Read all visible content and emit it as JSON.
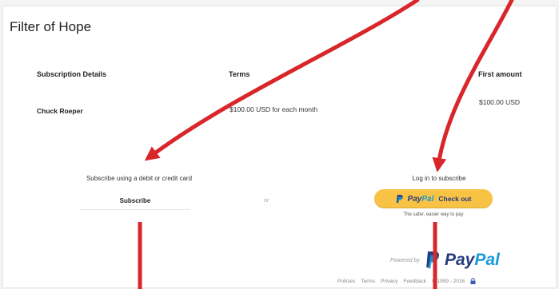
{
  "merchant": {
    "title": "Filter of Hope"
  },
  "table": {
    "headers": [
      "Subscription Details",
      "Terms",
      "First amount"
    ],
    "row": {
      "name": "Chuck Roeper",
      "terms": "$100.00 USD for each month",
      "amount": "$100.00 USD"
    }
  },
  "card": {
    "prompt": "Subscribe using a debit or credit card",
    "button": "Subscribe"
  },
  "separator": "or",
  "paypal": {
    "prompt": "Log in to subscribe",
    "brand_pay": "Pay",
    "brand_pal": "Pal",
    "cta": "Check out",
    "tagline": "The safer, easier way to pay",
    "powered_by": "Powered by",
    "brand_color_dark": "#253b80",
    "brand_color_light": "#179bd7",
    "button_color": "#f8c245"
  },
  "footer": {
    "links": [
      "Policies",
      "Terms",
      "Privacy",
      "Feedback"
    ],
    "copyright": "© 1999 - 2016"
  },
  "annotation": {
    "arrow_color": "#d8262a"
  }
}
